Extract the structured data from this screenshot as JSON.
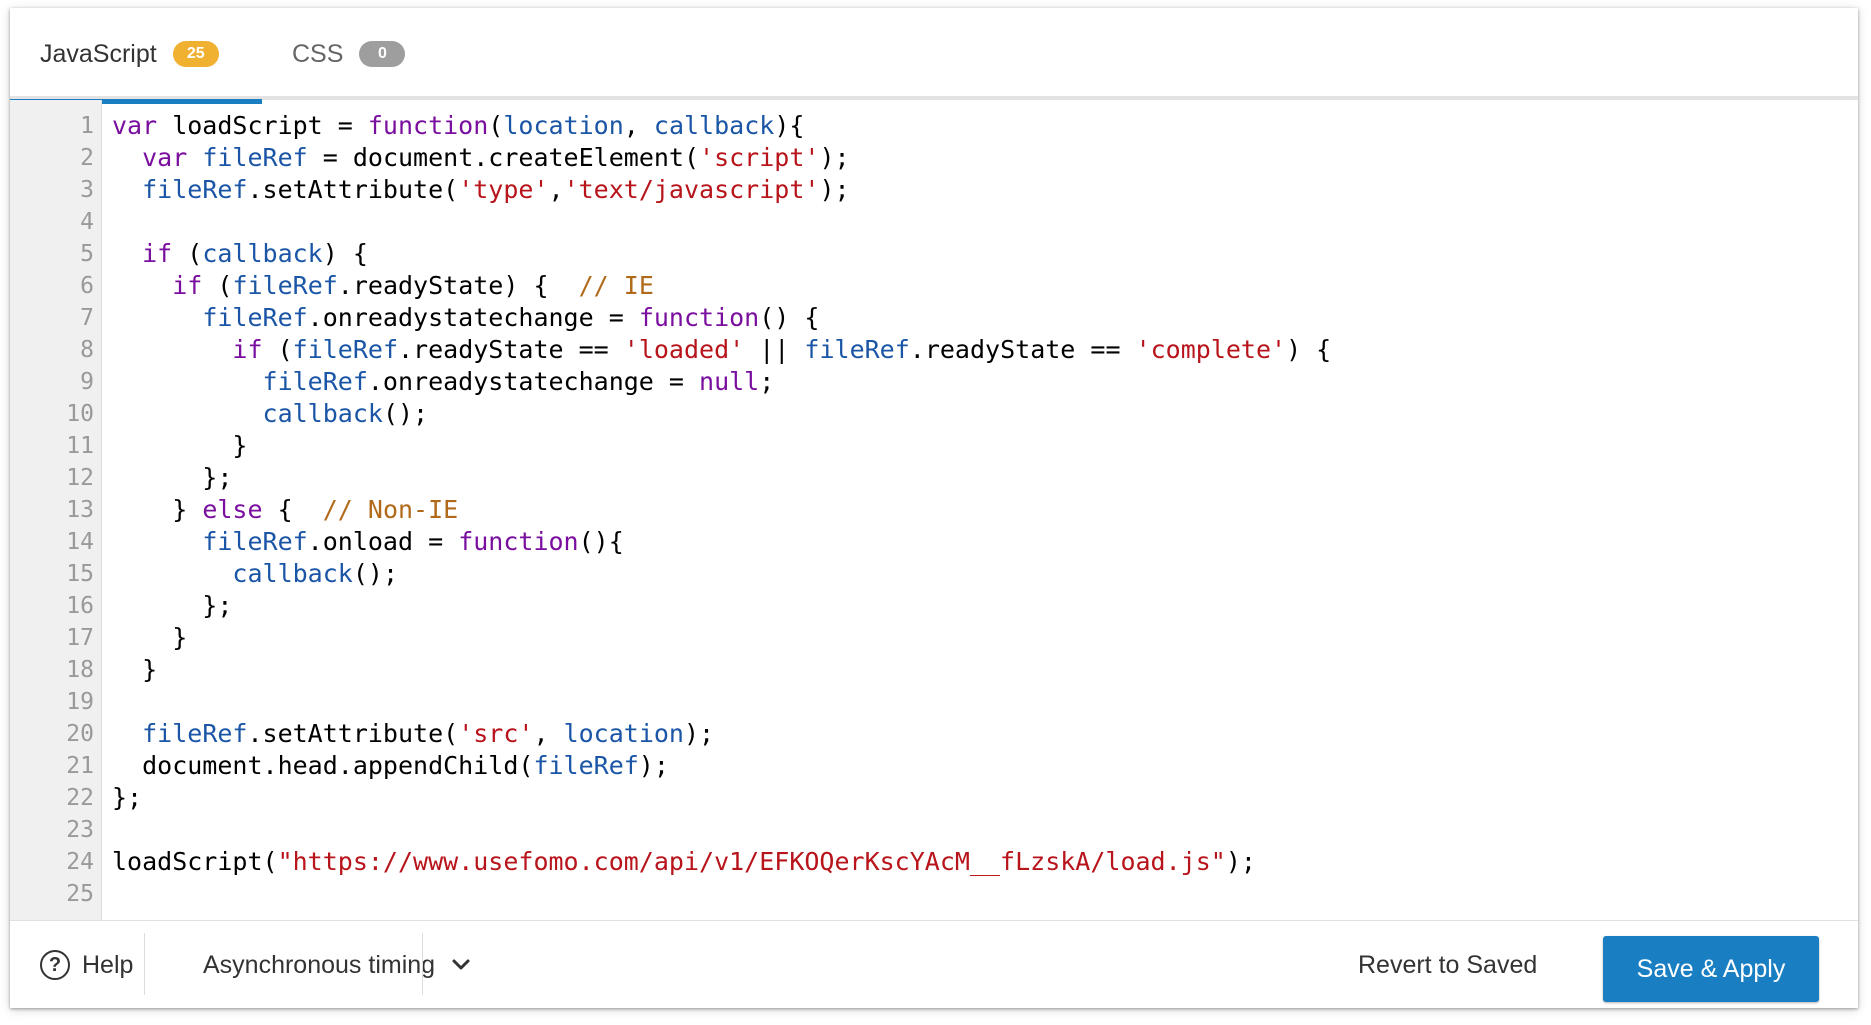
{
  "tabs": [
    {
      "label": "JavaScript",
      "badge": "25",
      "active": true
    },
    {
      "label": "CSS",
      "badge": "0",
      "active": false
    }
  ],
  "colors": {
    "accent": "#1a7ec3",
    "badge_active": "#f0b030",
    "badge_inactive": "#9e9e9e",
    "keyword": "#7a0f9f",
    "variable": "#1a55a6",
    "string": "#b8141b",
    "comment": "#b06a1a"
  },
  "editor": {
    "language": "javascript",
    "lines": [
      [
        [
          "kw",
          "var"
        ],
        [
          "plain",
          " loadScript = "
        ],
        [
          "kw",
          "function"
        ],
        [
          "plain",
          "("
        ],
        [
          "var",
          "location"
        ],
        [
          "plain",
          ", "
        ],
        [
          "var",
          "callback"
        ],
        [
          "plain",
          "){"
        ]
      ],
      [
        [
          "plain",
          "  "
        ],
        [
          "kw",
          "var"
        ],
        [
          "plain",
          " "
        ],
        [
          "var",
          "fileRef"
        ],
        [
          "plain",
          " = document.createElement("
        ],
        [
          "str",
          "'script'"
        ],
        [
          "plain",
          ");"
        ]
      ],
      [
        [
          "plain",
          "  "
        ],
        [
          "var",
          "fileRef"
        ],
        [
          "plain",
          ".setAttribute("
        ],
        [
          "str",
          "'type'"
        ],
        [
          "plain",
          ","
        ],
        [
          "str",
          "'text/javascript'"
        ],
        [
          "plain",
          ");"
        ]
      ],
      [],
      [
        [
          "plain",
          "  "
        ],
        [
          "kw",
          "if"
        ],
        [
          "plain",
          " ("
        ],
        [
          "var",
          "callback"
        ],
        [
          "plain",
          ") {"
        ]
      ],
      [
        [
          "plain",
          "    "
        ],
        [
          "kw",
          "if"
        ],
        [
          "plain",
          " ("
        ],
        [
          "var",
          "fileRef"
        ],
        [
          "plain",
          ".readyState) {  "
        ],
        [
          "com",
          "// IE"
        ]
      ],
      [
        [
          "plain",
          "      "
        ],
        [
          "var",
          "fileRef"
        ],
        [
          "plain",
          ".onreadystatechange = "
        ],
        [
          "kw",
          "function"
        ],
        [
          "plain",
          "() {"
        ]
      ],
      [
        [
          "plain",
          "        "
        ],
        [
          "kw",
          "if"
        ],
        [
          "plain",
          " ("
        ],
        [
          "var",
          "fileRef"
        ],
        [
          "plain",
          ".readyState == "
        ],
        [
          "str",
          "'loaded'"
        ],
        [
          "plain",
          " || "
        ],
        [
          "var",
          "fileRef"
        ],
        [
          "plain",
          ".readyState == "
        ],
        [
          "str",
          "'complete'"
        ],
        [
          "plain",
          ") {"
        ]
      ],
      [
        [
          "plain",
          "          "
        ],
        [
          "var",
          "fileRef"
        ],
        [
          "plain",
          ".onreadystatechange = "
        ],
        [
          "kw",
          "null"
        ],
        [
          "plain",
          ";"
        ]
      ],
      [
        [
          "plain",
          "          "
        ],
        [
          "var",
          "callback"
        ],
        [
          "plain",
          "();"
        ]
      ],
      [
        [
          "plain",
          "        }"
        ]
      ],
      [
        [
          "plain",
          "      };"
        ]
      ],
      [
        [
          "plain",
          "    } "
        ],
        [
          "kw",
          "else"
        ],
        [
          "plain",
          " {  "
        ],
        [
          "com",
          "// Non-IE"
        ]
      ],
      [
        [
          "plain",
          "      "
        ],
        [
          "var",
          "fileRef"
        ],
        [
          "plain",
          ".onload = "
        ],
        [
          "kw",
          "function"
        ],
        [
          "plain",
          "(){"
        ]
      ],
      [
        [
          "plain",
          "        "
        ],
        [
          "var",
          "callback"
        ],
        [
          "plain",
          "();"
        ]
      ],
      [
        [
          "plain",
          "      };"
        ]
      ],
      [
        [
          "plain",
          "    }"
        ]
      ],
      [
        [
          "plain",
          "  }"
        ]
      ],
      [],
      [
        [
          "plain",
          "  "
        ],
        [
          "var",
          "fileRef"
        ],
        [
          "plain",
          ".setAttribute("
        ],
        [
          "str",
          "'src'"
        ],
        [
          "plain",
          ", "
        ],
        [
          "var",
          "location"
        ],
        [
          "plain",
          ");"
        ]
      ],
      [
        [
          "plain",
          "  document.head.appendChild("
        ],
        [
          "var",
          "fileRef"
        ],
        [
          "plain",
          ");"
        ]
      ],
      [
        [
          "plain",
          "};"
        ]
      ],
      [],
      [
        [
          "plain",
          "loadScript("
        ],
        [
          "str",
          "\"https://www.usefomo.com/api/v1/EFKOQerKscYAcM__fLzskA/load.js\""
        ],
        [
          "plain",
          ");"
        ]
      ],
      []
    ]
  },
  "footer": {
    "help_label": "Help",
    "help_icon": "question-circle-icon",
    "timing_label": "Asynchronous timing",
    "timing_icon": "chevron-down-icon",
    "revert_label": "Revert to Saved",
    "save_label": "Save & Apply"
  }
}
